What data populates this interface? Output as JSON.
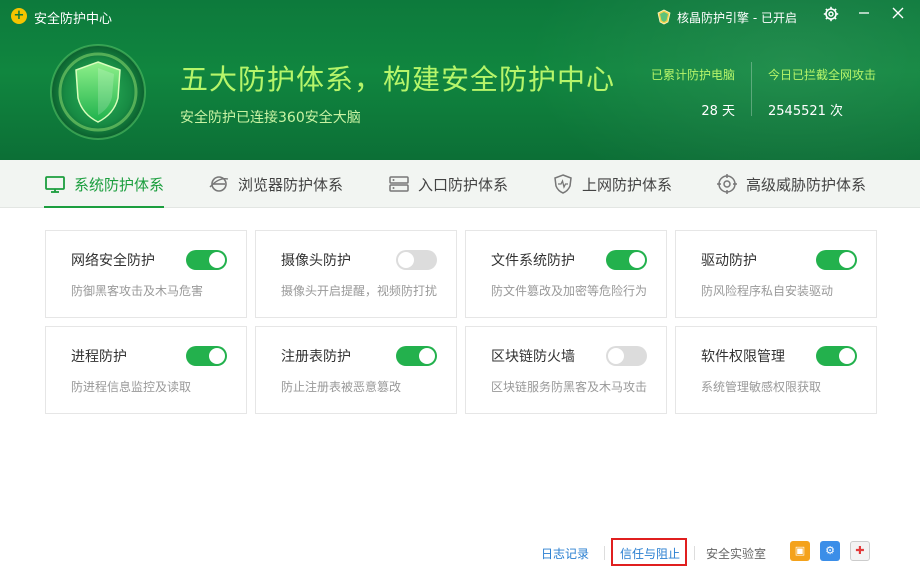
{
  "window": {
    "title": "安全防护中心",
    "engine_status": "核晶防护引擎 - 已开启",
    "controls": {
      "settings_icon": "gear-icon",
      "minimize_icon": "minimize-icon",
      "close_icon": "close-icon"
    }
  },
  "hero": {
    "headline": "五大防护体系，构建安全防护中心",
    "subline": "安全防护已连接360安全大脑",
    "stats": [
      {
        "label": "已累计防护电脑",
        "value": "28 天"
      },
      {
        "label": "今日已拦截全网攻击",
        "value": "2545521 次"
      }
    ]
  },
  "tabs": [
    {
      "label": "系统防护体系",
      "icon": "monitor-icon",
      "active": true
    },
    {
      "label": "浏览器防护体系",
      "icon": "browser-icon",
      "active": false
    },
    {
      "label": "入口防护体系",
      "icon": "server-icon",
      "active": false
    },
    {
      "label": "上网防护体系",
      "icon": "shield-pulse-icon",
      "active": false
    },
    {
      "label": "高级威胁防护体系",
      "icon": "radar-icon",
      "active": false
    }
  ],
  "cards": [
    {
      "name": "网络安全防护",
      "desc": "防御黑客攻击及木马危害",
      "enabled": true
    },
    {
      "name": "摄像头防护",
      "desc": "摄像头开启提醒，视频防打扰",
      "enabled": false
    },
    {
      "name": "文件系统防护",
      "desc": "防文件篡改及加密等危险行为",
      "enabled": true
    },
    {
      "name": "驱动防护",
      "desc": "防风险程序私自安装驱动",
      "enabled": true
    },
    {
      "name": "进程防护",
      "desc": "防进程信息监控及读取",
      "enabled": true
    },
    {
      "name": "注册表防护",
      "desc": "防止注册表被恶意篡改",
      "enabled": true
    },
    {
      "name": "区块链防火墙",
      "desc": "区块链服务防黑客及木马攻击",
      "enabled": false
    },
    {
      "name": "软件权限管理",
      "desc": "系统管理敏感权限获取",
      "enabled": true
    }
  ],
  "footer": {
    "log": "日志记录",
    "trust": "信任与阻止",
    "lab": "安全实验室",
    "icons": [
      "app-store-icon",
      "settings-tool-icon",
      "first-aid-kit-icon"
    ]
  },
  "colors": {
    "header_green": "#0d7a3c",
    "accent_green": "#1b9e3e",
    "toggle_on": "#23b14d",
    "highlight_red": "#e01f1f",
    "link_blue": "#2a7fd1"
  }
}
